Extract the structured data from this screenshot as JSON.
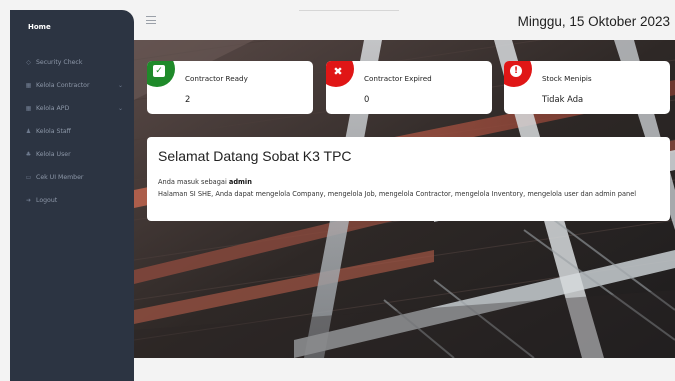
{
  "sidebar": {
    "home_label": "Home",
    "items": [
      {
        "label": "Security Check",
        "icon": "shield-icon",
        "has_submenu": false
      },
      {
        "label": "Kelola Contractor",
        "icon": "grid-icon",
        "has_submenu": true
      },
      {
        "label": "Kelola APD",
        "icon": "grid-icon",
        "has_submenu": true
      },
      {
        "label": "Kelola Staff",
        "icon": "person-icon",
        "has_submenu": false
      },
      {
        "label": "Kelola User",
        "icon": "users-icon",
        "has_submenu": false
      },
      {
        "label": "Cek UI Member",
        "icon": "monitor-icon",
        "has_submenu": false
      },
      {
        "label": "Logout",
        "icon": "logout-icon",
        "has_submenu": false
      }
    ]
  },
  "header": {
    "date": "Minggu, 15 Oktober 2023"
  },
  "cards": [
    {
      "title": "Contractor Ready",
      "value": "2",
      "status": "ready",
      "icon": "check-icon",
      "color": "#1f8a2a"
    },
    {
      "title": "Contractor Expired",
      "value": "0",
      "status": "expired",
      "icon": "x-icon",
      "color": "#e01616"
    },
    {
      "title": "Stock Menipis",
      "value": "Tidak Ada",
      "status": "warning",
      "icon": "exclamation-icon",
      "color": "#e01616"
    }
  ],
  "welcome": {
    "heading": "Selamat Datang Sobat K3 TPC",
    "role_prefix": "Anda masuk sebagai",
    "role": "admin",
    "description": "Halaman SI SHE, Anda dapat mengelola Company, mengelola Job, mengelola Contractor, mengelola Inventory, mengelola user dan admin panel"
  }
}
